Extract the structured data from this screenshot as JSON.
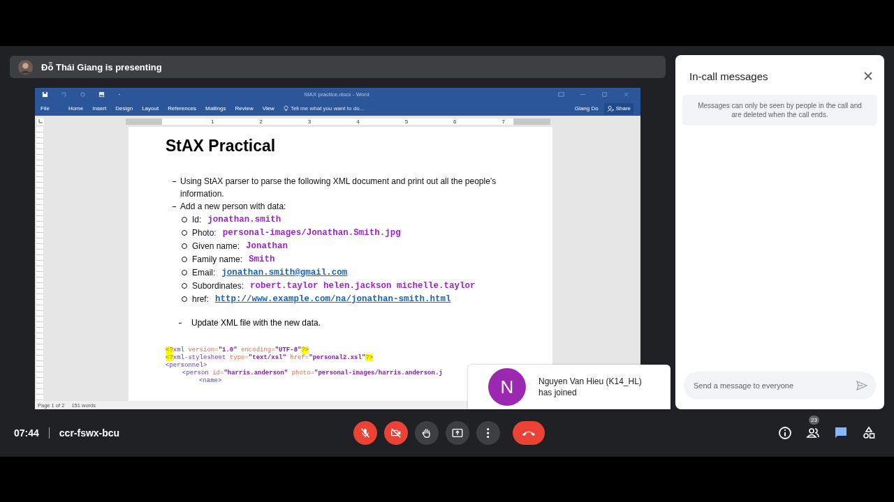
{
  "presenter": {
    "name": "Đỗ Thái Giang is presenting"
  },
  "word": {
    "title": "StAX practice.docx - Word",
    "tabs": [
      {
        "label": "File",
        "selected": false
      },
      {
        "label": "Home",
        "selected": false
      },
      {
        "label": "Insert",
        "selected": false
      },
      {
        "label": "Design",
        "selected": false
      },
      {
        "label": "Layout",
        "selected": false
      },
      {
        "label": "References",
        "selected": false
      },
      {
        "label": "Mailings",
        "selected": false
      },
      {
        "label": "Review",
        "selected": false
      },
      {
        "label": "View",
        "selected": false
      }
    ],
    "tell_me": "Tell me what you want to do...",
    "user": "Giang Do",
    "share": "Share",
    "ruler": [
      "1",
      "2",
      "3",
      "4",
      "5",
      "6",
      "7"
    ],
    "document": {
      "heading": "StAX Practical",
      "items": [
        {
          "text": "Using StAX parser to parse the following XML document and print out all the people’s information."
        },
        {
          "text": "Add a new person with data:",
          "children": [
            {
              "label": "Id:",
              "value": "jonathan.smith",
              "kind": "code"
            },
            {
              "label": "Photo:",
              "value": "personal-images/Jonathan.Smith.jpg",
              "kind": "code"
            },
            {
              "label": "Given name:",
              "value": "Jonathan",
              "kind": "code"
            },
            {
              "label": "Family name:",
              "value": "Smith",
              "kind": "code"
            },
            {
              "label": "Email:",
              "value": "jonathan.smith@gmail.com",
              "kind": "link"
            },
            {
              "label": "Subordinates:",
              "value": "robert.taylor helen.jackson michelle.taylor",
              "kind": "code"
            },
            {
              "label": "href:",
              "value": "http://www.example.com/na/jonathan-smith.html",
              "kind": "link"
            }
          ]
        }
      ],
      "final_item": "Update XML file with the new data.",
      "code_lines": [
        {
          "kind": "top",
          "segments": [
            {
              "kind": "mark",
              "text": "<?"
            },
            {
              "kind": "tag",
              "text": "xml "
            },
            {
              "kind": "attr",
              "text": "version="
            },
            {
              "kind": "value",
              "text": "\"1.0\" "
            },
            {
              "kind": "attr",
              "text": "encoding="
            },
            {
              "kind": "value",
              "text": "\"UTF-8\""
            },
            {
              "kind": "mark",
              "text": "?>"
            }
          ]
        },
        {
          "kind": "top",
          "segments": [
            {
              "kind": "mark",
              "text": "<?"
            },
            {
              "kind": "tag",
              "text": "xml-stylesheet "
            },
            {
              "kind": "attr",
              "text": "type="
            },
            {
              "kind": "value",
              "text": "\"text/xsl\" "
            },
            {
              "kind": "attr",
              "text": "href="
            },
            {
              "kind": "value",
              "text": "\"personal2.xsl\""
            },
            {
              "kind": "mark",
              "text": "?>"
            }
          ]
        },
        {
          "kind": "top",
          "segments": [
            {
              "kind": "tag",
              "text": "<personnel>"
            }
          ]
        },
        {
          "kind": "child",
          "segments": [
            {
              "kind": "tag",
              "text": "<person "
            },
            {
              "kind": "attr",
              "text": "id="
            },
            {
              "kind": "value",
              "text": "\"harris.anderson\" "
            },
            {
              "kind": "attr",
              "text": "photo="
            },
            {
              "kind": "value",
              "text": "\"personal-images/harris.anderson.j"
            }
          ]
        },
        {
          "kind": "grandchild",
          "segments": [
            {
              "kind": "tag",
              "text": "<name>"
            }
          ]
        }
      ]
    },
    "status": {
      "page": "Page 1 of 2",
      "words": "151 words"
    }
  },
  "toast": {
    "initial": "N",
    "color": "#9c27b0",
    "message": "Nguyen Van Hieu (K14_HL) has joined"
  },
  "chat": {
    "title": "In-call messages",
    "notice": "Messages can only be seen by people in the call and are deleted when the call ends.",
    "placeholder": "Send a message to everyone"
  },
  "footer": {
    "time": "07:44",
    "meeting_code": "ccr-fswx-bcu",
    "participants": "23",
    "controls": [
      {
        "kind": "mic",
        "muted": true
      },
      {
        "kind": "camera",
        "muted": true
      },
      {
        "kind": "hand"
      },
      {
        "kind": "present"
      },
      {
        "kind": "more"
      },
      {
        "kind": "hangup"
      }
    ]
  }
}
